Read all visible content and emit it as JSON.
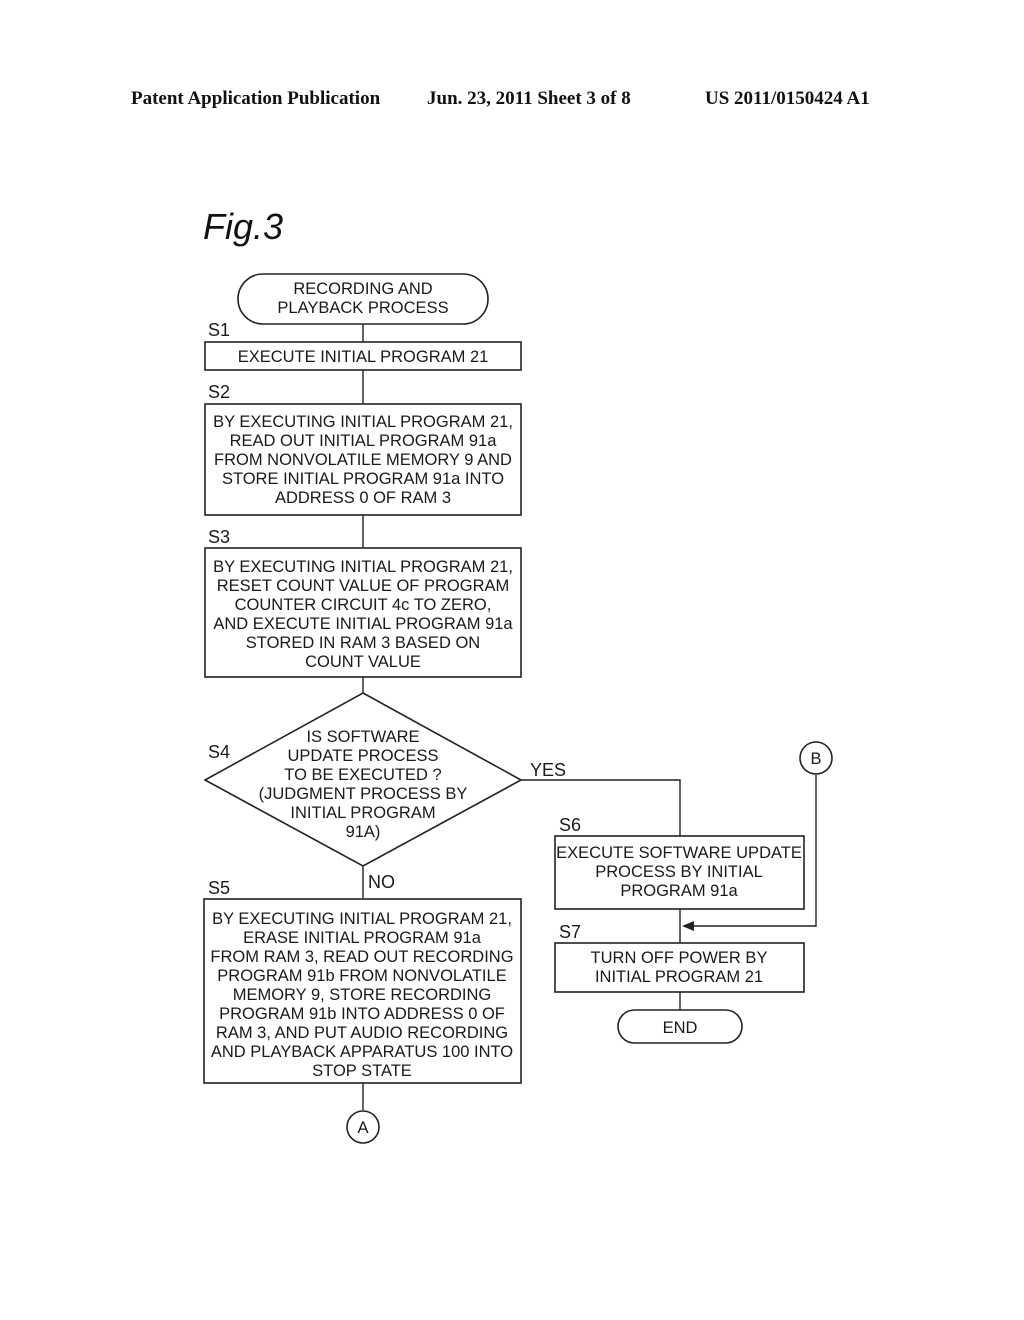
{
  "header": {
    "left": "Patent Application Publication",
    "middle": "Jun. 23, 2011  Sheet 3 of 8",
    "right": "US 2011/0150424 A1"
  },
  "figure": {
    "label": "Fig.3",
    "start": {
      "lines": [
        "RECORDING AND",
        "PLAYBACK PROCESS"
      ]
    },
    "steps": {
      "s1": {
        "id": "S1",
        "lines": [
          "EXECUTE INITIAL PROGRAM 21"
        ]
      },
      "s2": {
        "id": "S2",
        "lines": [
          "BY EXECUTING INITIAL PROGRAM 21,",
          "READ OUT INITIAL PROGRAM 91a",
          "FROM NONVOLATILE MEMORY 9 AND",
          "STORE INITIAL PROGRAM 91a INTO",
          "ADDRESS 0 OF RAM 3"
        ]
      },
      "s3": {
        "id": "S3",
        "lines": [
          "BY EXECUTING INITIAL PROGRAM 21,",
          "RESET COUNT VALUE OF PROGRAM",
          "COUNTER CIRCUIT 4c TO ZERO,",
          "AND EXECUTE INITIAL PROGRAM 91a",
          "STORED IN RAM 3 BASED ON",
          "COUNT VALUE"
        ]
      },
      "s4": {
        "id": "S4",
        "lines": [
          "IS SOFTWARE",
          "UPDATE PROCESS",
          "TO BE EXECUTED ?",
          "(JUDGMENT PROCESS BY",
          "INITIAL PROGRAM",
          "91A)"
        ],
        "yes_label": "YES",
        "no_label": "NO"
      },
      "s5": {
        "id": "S5",
        "lines": [
          "BY EXECUTING INITIAL PROGRAM 21,",
          "ERASE INITIAL PROGRAM 91a",
          "FROM RAM 3, READ OUT RECORDING",
          "PROGRAM 91b FROM NONVOLATILE",
          "MEMORY 9, STORE RECORDING",
          "PROGRAM 91b INTO ADDRESS 0 OF",
          "RAM 3, AND PUT AUDIO RECORDING",
          "AND PLAYBACK APPARATUS 100 INTO",
          "STOP STATE"
        ]
      },
      "s6": {
        "id": "S6",
        "lines": [
          "EXECUTE SOFTWARE UPDATE",
          "PROCESS BY INITIAL",
          "PROGRAM 91a"
        ]
      },
      "s7": {
        "id": "S7",
        "lines": [
          "TURN OFF POWER BY",
          "INITIAL PROGRAM 21"
        ]
      }
    },
    "end": {
      "lines": [
        "END"
      ]
    },
    "connectors": {
      "a": "A",
      "b": "B"
    }
  }
}
